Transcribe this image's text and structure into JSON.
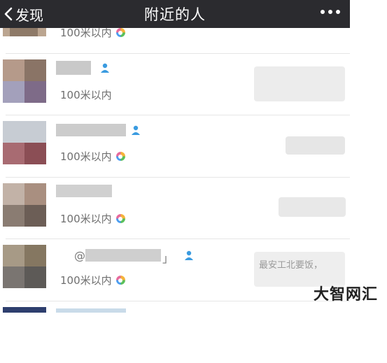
{
  "nav": {
    "back_label": "发现",
    "title": "附近的人",
    "more_icon": "more-dots-icon",
    "back_icon": "chevron-left-icon"
  },
  "rows": [
    {
      "distance": "100米以内",
      "has_ring": true
    },
    {
      "distance": "100米以内",
      "has_ring": false
    },
    {
      "distance": "100米以内",
      "has_ring": true
    },
    {
      "distance": "100米以内",
      "has_ring": true
    },
    {
      "distance": "100米以内",
      "has_ring": true,
      "name_fragment": "@",
      "name_end": "」",
      "signature": "最安工北要饭，"
    }
  ],
  "watermark": "大智网汇",
  "colors": {
    "nav_bg": "#2b2b2f",
    "gender_icon": "#3a9be0",
    "distance_text": "#6f6f6f"
  }
}
